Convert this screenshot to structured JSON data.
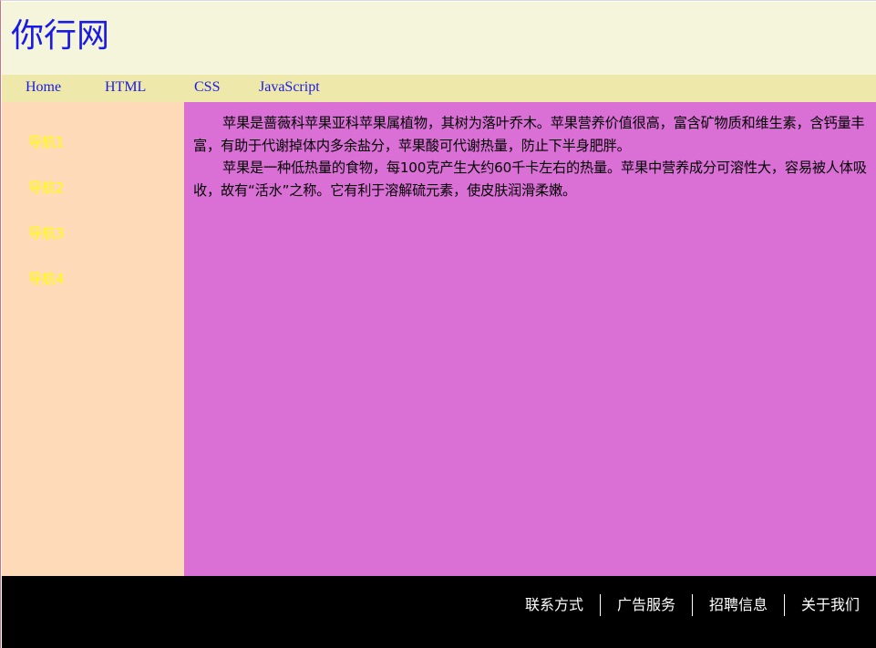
{
  "header": {
    "logo": "你行网"
  },
  "topnav": {
    "items": [
      "Home",
      "HTML",
      "CSS",
      "JavaScript"
    ]
  },
  "sidebar": {
    "items": [
      "导航1",
      "导航2",
      "导航3",
      "导航4"
    ]
  },
  "content": {
    "paragraphs": [
      "苹果是蔷薇科苹果亚科苹果属植物，其树为落叶乔木。苹果营养价值很高，富含矿物质和维生素，含钙量丰富，有助于代谢掉体内多余盐分，苹果酸可代谢热量，防止下半身肥胖。",
      "苹果是一种低热量的食物，每100克产生大约60千卡左右的热量。苹果中营养成分可溶性大，容易被人体吸收，故有“活水”之称。它有利于溶解硫元素，使皮肤润滑柔嫩。"
    ]
  },
  "footer": {
    "links": [
      "联系方式",
      "广告服务",
      "招聘信息",
      "关于我们"
    ]
  },
  "colors": {
    "header_bg": "#f5f5dc",
    "topnav_bg": "#eee8aa",
    "sidebar_bg": "#ffdab9",
    "content_bg": "#da70d6",
    "footer_bg": "#000000",
    "link_blue": "#1a1ae6",
    "sidebar_link": "#ffff00"
  }
}
